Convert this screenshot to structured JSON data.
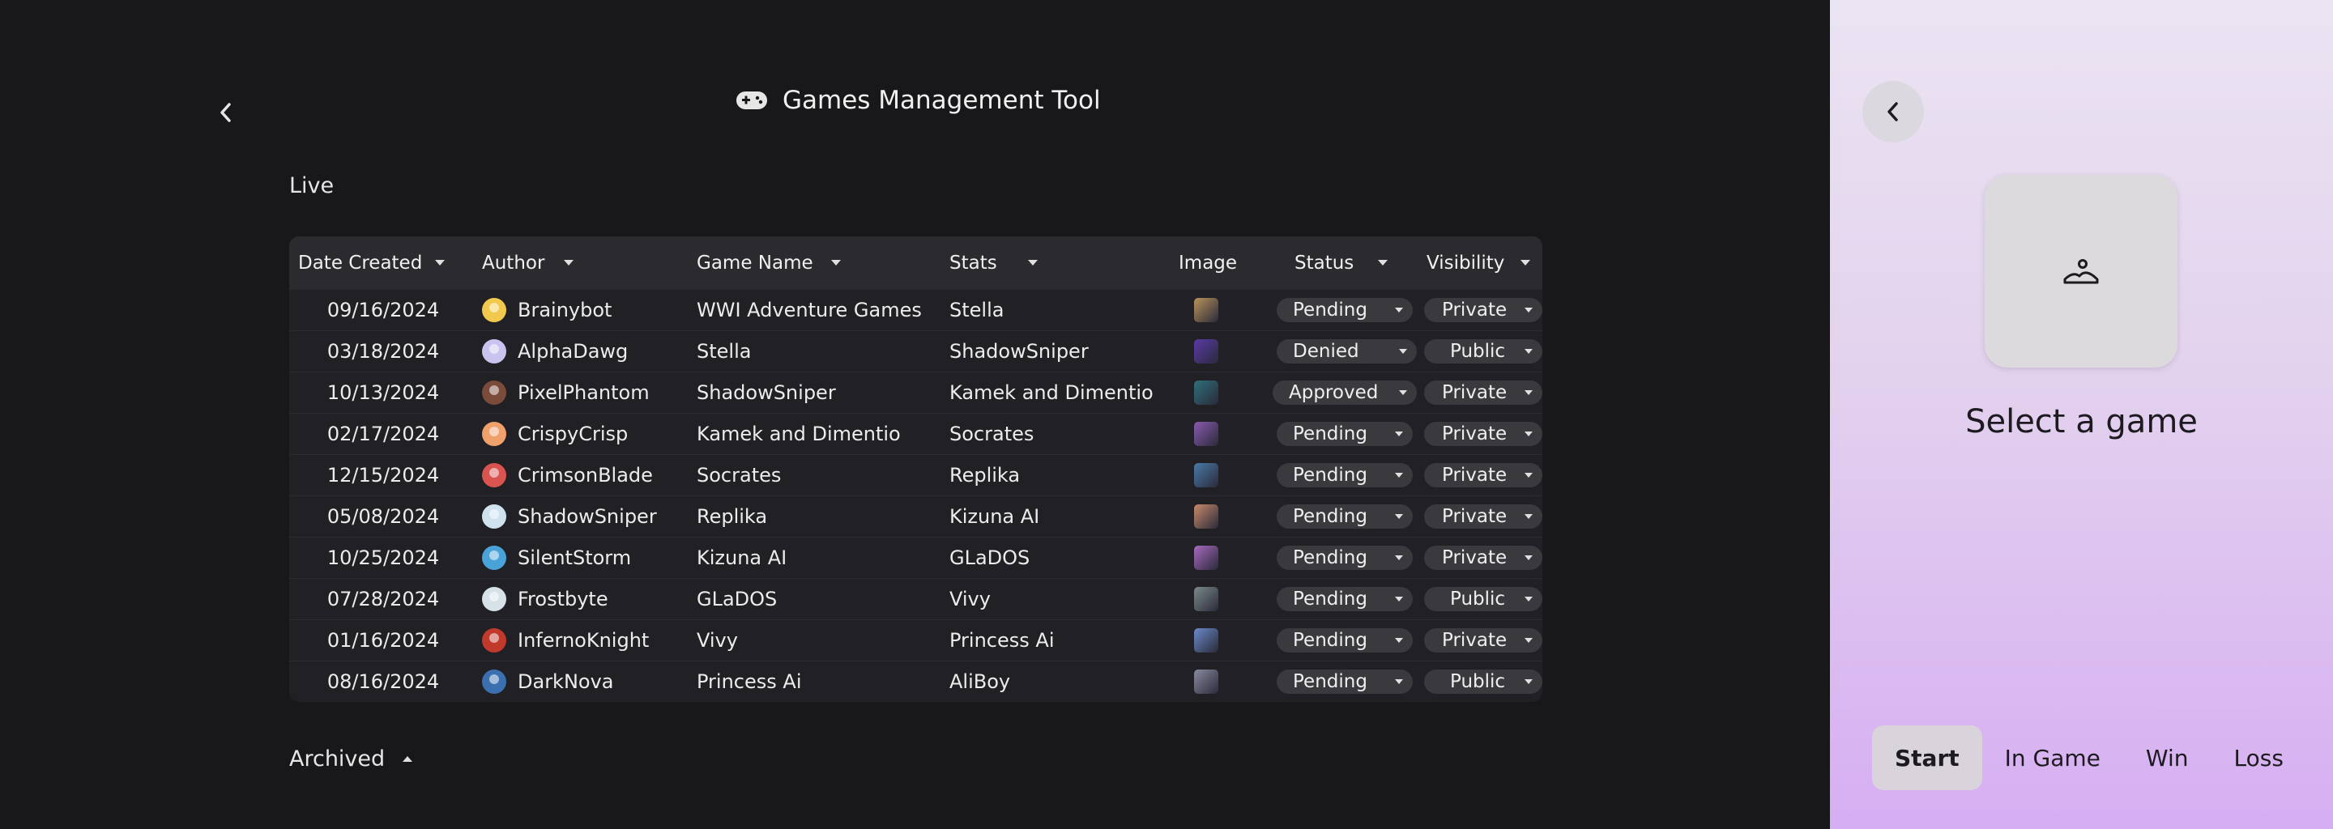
{
  "header": {
    "title": "Games Management Tool",
    "back_icon": "chevron-left-icon",
    "title_icon": "gamepad-icon"
  },
  "live": {
    "heading": "Live",
    "columns": [
      "Date Created",
      "Author",
      "Game Name",
      "Stats",
      "Image",
      "Status",
      "Visibility"
    ],
    "rows": [
      {
        "date": "09/16/2024",
        "author": "Brainybot",
        "game": "WWI Adventure Games",
        "stats": "Stella",
        "status": "Pending",
        "visibility": "Private",
        "avatar_color": "#f2c94c",
        "thumb_color": "#b9935a"
      },
      {
        "date": "03/18/2024",
        "author": "AlphaDawg",
        "game": "Stella",
        "stats": "ShadowSniper",
        "status": "Denied",
        "visibility": "Public",
        "avatar_color": "#c9c3f0",
        "thumb_color": "#5a3aa8"
      },
      {
        "date": "10/13/2024",
        "author": "PixelPhantom",
        "game": "ShadowSniper",
        "stats": "Kamek and Dimentio",
        "status": "Approved",
        "visibility": "Private",
        "avatar_color": "#7a4a3a",
        "thumb_color": "#2f6f7a"
      },
      {
        "date": "02/17/2024",
        "author": "CrispyCrisp",
        "game": "Kamek and Dimentio",
        "stats": "Socrates",
        "status": "Pending",
        "visibility": "Private",
        "avatar_color": "#f0a06a",
        "thumb_color": "#8a5ab0"
      },
      {
        "date": "12/15/2024",
        "author": "CrimsonBlade",
        "game": "Socrates",
        "stats": "Replika",
        "status": "Pending",
        "visibility": "Private",
        "avatar_color": "#d9534f",
        "thumb_color": "#4a7aa8"
      },
      {
        "date": "05/08/2024",
        "author": "ShadowSniper",
        "game": "Replika",
        "stats": "Kizuna AI",
        "status": "Pending",
        "visibility": "Private",
        "avatar_color": "#cfe3ef",
        "thumb_color": "#c98a6a"
      },
      {
        "date": "10/25/2024",
        "author": "SilentStorm",
        "game": "Kizuna AI",
        "stats": "GLaDOS",
        "status": "Pending",
        "visibility": "Private",
        "avatar_color": "#4aa3d8",
        "thumb_color": "#a86ac0"
      },
      {
        "date": "07/28/2024",
        "author": "Frostbyte",
        "game": "GLaDOS",
        "stats": "Vivy",
        "status": "Pending",
        "visibility": "Public",
        "avatar_color": "#d6e2e8",
        "thumb_color": "#7a8a8a"
      },
      {
        "date": "01/16/2024",
        "author": "InfernoKnight",
        "game": "Vivy",
        "stats": "Princess Ai",
        "status": "Pending",
        "visibility": "Private",
        "avatar_color": "#c0392b",
        "thumb_color": "#6a8ac8"
      },
      {
        "date": "08/16/2024",
        "author": "DarkNova",
        "game": "Princess Ai",
        "stats": "AliBoy",
        "status": "Pending",
        "visibility": "Public",
        "avatar_color": "#3a6fb0",
        "thumb_color": "#8a8aa0"
      }
    ]
  },
  "archived": {
    "heading": "Archived"
  },
  "preview": {
    "back_icon": "chevron-left-icon",
    "placeholder_icon": "image-placeholder-icon",
    "label": "Select a game",
    "tabs": [
      "Start",
      "In Game",
      "Win",
      "Loss"
    ],
    "active_tab": "Start"
  },
  "colors": {
    "background": "#18171a",
    "table_bg": "#212024",
    "pill_bg": "#3a393e",
    "side_top": "#ebe4f2",
    "side_bottom": "#d6aef2"
  }
}
